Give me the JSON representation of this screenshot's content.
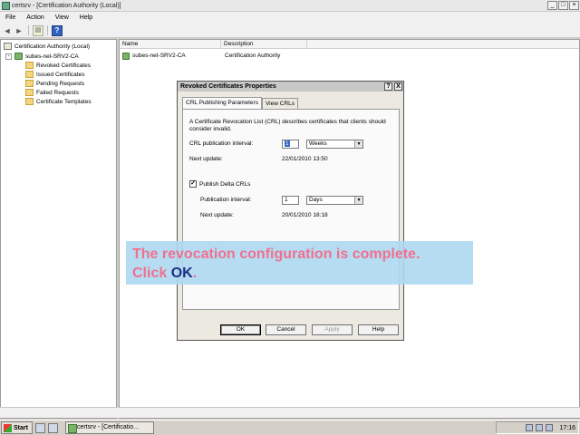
{
  "window": {
    "title": "certsrv - [Certification Authority (Local)]"
  },
  "menu": [
    "File",
    "Action",
    "View",
    "Help"
  ],
  "toolbar": {
    "icons": [
      "back-arrow-icon",
      "forward-arrow-icon",
      "up-level-icon",
      "help-icon"
    ]
  },
  "tree": {
    "root": "Certification Authority (Local)",
    "ca": "subes-net-SRV2-CA",
    "items": [
      "Revoked Certificates",
      "Issued Certificates",
      "Pending Requests",
      "Failed Requests",
      "Certificate Templates"
    ]
  },
  "list": {
    "columns": [
      "Name",
      "Description"
    ],
    "rows": [
      {
        "name": "subes-net-SRV2-CA",
        "description": "Certification Authority"
      }
    ]
  },
  "dialog": {
    "title": "Revoked Certificates Properties",
    "help_button": "?",
    "close_button": "X",
    "tabs": [
      "CRL Publishing Parameters",
      "View CRLs"
    ],
    "description_line1": "A Certificate Revocation List (CRL) describes certificates that clients should",
    "description_line2": "consider invalid.",
    "crl_interval_label": "CRL publication interval:",
    "crl_interval_value": "1",
    "crl_interval_unit": "Weeks",
    "next_update_label": "Next update:",
    "next_update_value": "22/01/2010 13:50",
    "publish_delta_checked": true,
    "publish_delta_label": "Publish Delta CRLs",
    "delta_interval_label": "Publication interval:",
    "delta_interval_value": "1",
    "delta_interval_unit": "Days",
    "delta_next_update_label": "Next update:",
    "delta_next_update_value": "20/01/2010 18:18",
    "buttons": {
      "ok": "OK",
      "cancel": "Cancel",
      "apply": "Apply",
      "help": "Help"
    }
  },
  "instruction": {
    "line1": "The revocation configuration is complete.",
    "line2_prefix": "Click ",
    "line2_highlight": "OK",
    "line2_suffix": ".",
    "text_color": "#f07090",
    "highlight_color": "#1a2f86",
    "background": "#add8f0"
  },
  "taskbar": {
    "start": "Start",
    "task": "certsrv - [Certificatio...",
    "time": "17:16"
  }
}
